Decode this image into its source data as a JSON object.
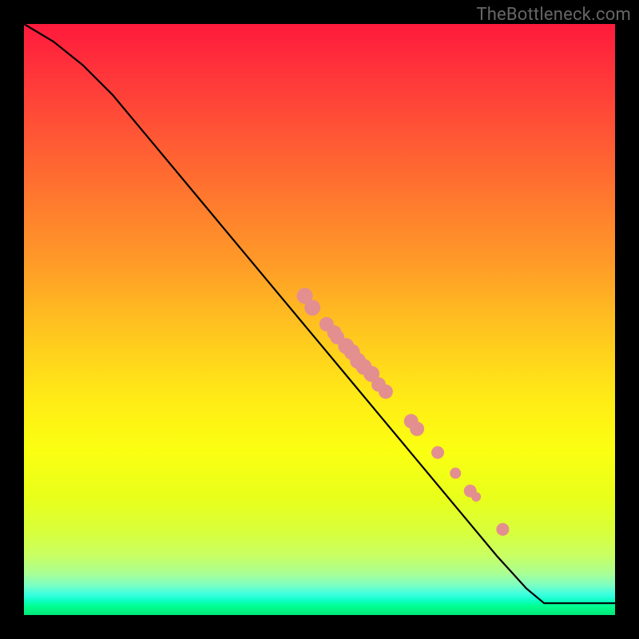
{
  "watermark": "TheBottleneck.com",
  "chart_data": {
    "type": "line",
    "title": "",
    "xlabel": "",
    "ylabel": "",
    "xlim": [
      0,
      1
    ],
    "ylim": [
      0,
      1
    ],
    "curve": [
      {
        "x": 0.0,
        "y": 1.0
      },
      {
        "x": 0.05,
        "y": 0.97
      },
      {
        "x": 0.1,
        "y": 0.93
      },
      {
        "x": 0.15,
        "y": 0.88
      },
      {
        "x": 0.2,
        "y": 0.82
      },
      {
        "x": 0.25,
        "y": 0.76
      },
      {
        "x": 0.3,
        "y": 0.7
      },
      {
        "x": 0.35,
        "y": 0.64
      },
      {
        "x": 0.4,
        "y": 0.58
      },
      {
        "x": 0.45,
        "y": 0.52
      },
      {
        "x": 0.5,
        "y": 0.46
      },
      {
        "x": 0.55,
        "y": 0.4
      },
      {
        "x": 0.6,
        "y": 0.34
      },
      {
        "x": 0.65,
        "y": 0.28
      },
      {
        "x": 0.7,
        "y": 0.22
      },
      {
        "x": 0.75,
        "y": 0.16
      },
      {
        "x": 0.8,
        "y": 0.1
      },
      {
        "x": 0.85,
        "y": 0.045
      },
      {
        "x": 0.88,
        "y": 0.02
      },
      {
        "x": 0.9,
        "y": 0.02
      },
      {
        "x": 1.0,
        "y": 0.02
      }
    ],
    "markers": [
      {
        "x": 0.475,
        "y": 0.54,
        "r": 10
      },
      {
        "x": 0.488,
        "y": 0.52,
        "r": 10
      },
      {
        "x": 0.512,
        "y": 0.492,
        "r": 9
      },
      {
        "x": 0.525,
        "y": 0.478,
        "r": 9
      },
      {
        "x": 0.53,
        "y": 0.47,
        "r": 9
      },
      {
        "x": 0.545,
        "y": 0.455,
        "r": 10
      },
      {
        "x": 0.555,
        "y": 0.445,
        "r": 10
      },
      {
        "x": 0.565,
        "y": 0.43,
        "r": 10
      },
      {
        "x": 0.575,
        "y": 0.42,
        "r": 10
      },
      {
        "x": 0.588,
        "y": 0.408,
        "r": 10
      },
      {
        "x": 0.6,
        "y": 0.39,
        "r": 9
      },
      {
        "x": 0.612,
        "y": 0.378,
        "r": 9
      },
      {
        "x": 0.655,
        "y": 0.328,
        "r": 9
      },
      {
        "x": 0.665,
        "y": 0.315,
        "r": 9
      },
      {
        "x": 0.7,
        "y": 0.275,
        "r": 8
      },
      {
        "x": 0.73,
        "y": 0.24,
        "r": 7
      },
      {
        "x": 0.755,
        "y": 0.21,
        "r": 8
      },
      {
        "x": 0.765,
        "y": 0.2,
        "r": 6
      },
      {
        "x": 0.81,
        "y": 0.145,
        "r": 8
      }
    ],
    "marker_color": "#e38f8f",
    "background_gradient": {
      "top": "#ff1a3c",
      "mid": "#ffed16",
      "bottom": "#00e878"
    }
  }
}
